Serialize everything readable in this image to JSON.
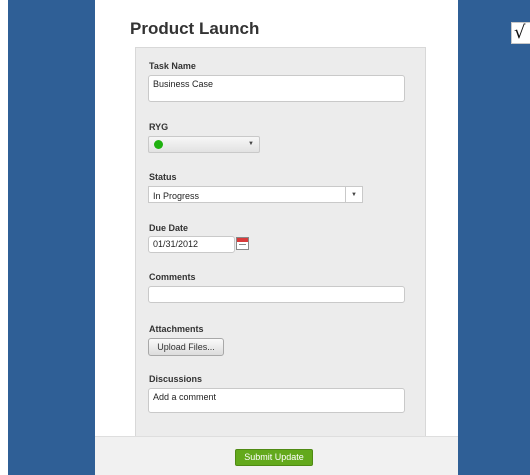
{
  "form": {
    "title": "Product Launch",
    "fields": {
      "task_name": {
        "label": "Task Name",
        "value": "Business Case"
      },
      "ryg": {
        "label": "RYG",
        "value_color": "#1fb10f"
      },
      "status": {
        "label": "Status",
        "value": "In Progress"
      },
      "due_date": {
        "label": "Due Date",
        "value": "01/31/2012"
      },
      "comments": {
        "label": "Comments",
        "value": ""
      },
      "attachments": {
        "label": "Attachments",
        "button_label": "Upload Files..."
      },
      "discussions": {
        "label": "Discussions",
        "placeholder": "Add a comment"
      }
    },
    "submit_label": "Submit Update"
  },
  "sidebar_right": {
    "icon": "checkmark-icon",
    "glyph": "√"
  },
  "colors": {
    "side_panel": "#2f5f96",
    "submit": "#63a91c",
    "ryg_green": "#1fb10f"
  }
}
